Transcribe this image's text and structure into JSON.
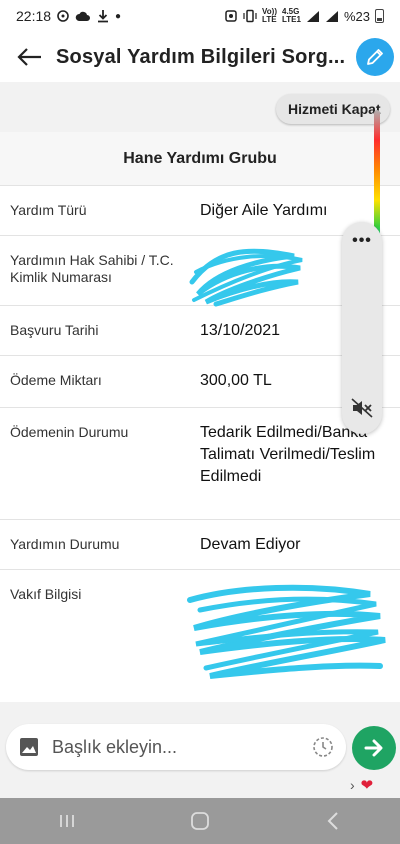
{
  "status_bar": {
    "time": "22:18",
    "network_top": "Vo))",
    "network_bottom": "LTE",
    "network2_top": "4.5G",
    "network2_bottom": "LTE1",
    "battery_text": "%23"
  },
  "header": {
    "title": "Sosyal Yardım Bilgileri Sorg..."
  },
  "chip": {
    "label": "Hizmeti Kapat"
  },
  "card": {
    "title": "Hane Yardımı Grubu",
    "rows": [
      {
        "label": "Yardım Türü",
        "value": "Diğer Aile Yardımı"
      },
      {
        "label": "Yardımın Hak Sahibi / T.C. Kimlik Numarası",
        "value": ""
      },
      {
        "label": "Başvuru Tarihi",
        "value": "13/10/2021"
      },
      {
        "label": "Ödeme Miktarı",
        "value": "300,00 TL"
      },
      {
        "label": "Ödemenin Durumu",
        "value": "Tedarik Edilmedi/Banka Talimatı Verilmedi/Teslim Edilmedi"
      },
      {
        "label": "Yardımın Durumu",
        "value": "Devam Ediyor"
      },
      {
        "label": "Vakıf Bilgisi",
        "value": ""
      }
    ]
  },
  "volume_panel": {
    "dots": "•••"
  },
  "message": {
    "placeholder": "Başlık ekleyin..."
  },
  "colors": {
    "accent": "#2ba7ec",
    "send": "#1fa463",
    "scribble": "#35c8ec"
  },
  "icons": [
    "back-icon",
    "pencil-icon",
    "mute-icon",
    "gallery-icon",
    "timer-icon",
    "send-icon",
    "recent-apps-icon",
    "home-icon",
    "back-nav-icon"
  ]
}
